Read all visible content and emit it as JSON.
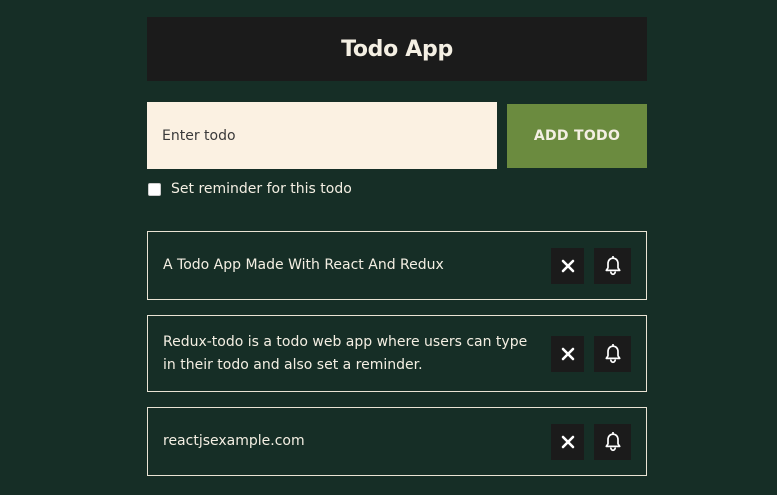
{
  "header": {
    "title": "Todo App"
  },
  "form": {
    "input_placeholder": "Enter todo",
    "input_value": "",
    "add_button_label": "ADD TODO",
    "reminder_label": "Set reminder for this todo",
    "reminder_checked": false
  },
  "todos": [
    {
      "text": "A Todo App Made With React And Redux"
    },
    {
      "text": "Redux-todo is a todo web app where users can type in their todo and also set a reminder."
    },
    {
      "text": "reactjsexample.com"
    }
  ],
  "colors": {
    "background": "#162e26",
    "header_bg": "#1b1b1b",
    "input_bg": "#fbf1e2",
    "accent": "#6b8b3f",
    "text": "#f4efe3"
  },
  "icons": {
    "delete": "close-icon",
    "reminder": "bell-icon"
  }
}
